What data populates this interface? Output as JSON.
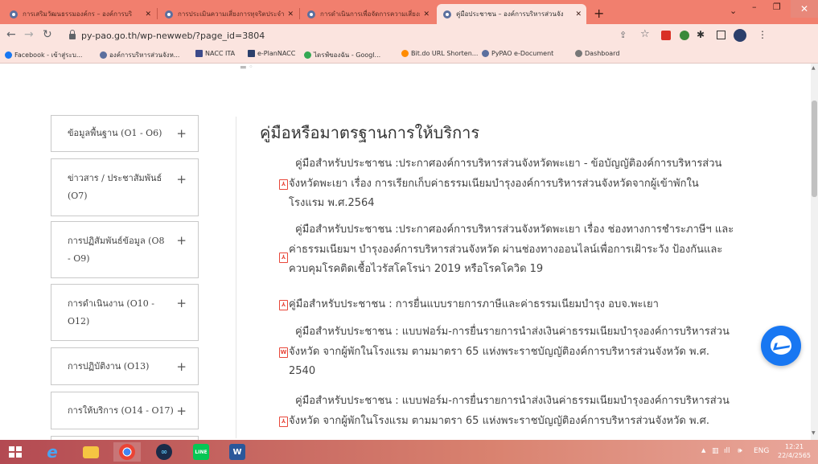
{
  "browser": {
    "tabs": [
      {
        "title": "การเสริมวัฒนธรรมองค์กร – องค์การบริ"
      },
      {
        "title": "การประเมินความเสี่ยงการทุจริตประจำปี"
      },
      {
        "title": "การดำเนินการเพื่อจัดการความเสี่ยงการ"
      },
      {
        "title": "คู่มือประชาชน – องค์การบริหารส่วนจัง",
        "active": true
      }
    ],
    "new_tab": "+",
    "url": "py-pao.go.th/wp-newweb/?page_id=3804",
    "bookmarks": [
      {
        "label": "Facebook - เข้าสู่ระบ...",
        "color": "#1877f2"
      },
      {
        "label": "องค์การบริหารส่วนจังห...",
        "color": "#5b6f9e"
      },
      {
        "label": "NACC ITA",
        "color": "#3c4a8a"
      },
      {
        "label": "e-PlanNACC",
        "color": "#2b3f6b"
      },
      {
        "label": "ไดรฟ์ของฉัน - Googl...",
        "color": "#34a853"
      },
      {
        "label": "Bit.do URL Shorten...",
        "color": "#ff8c00"
      },
      {
        "label": "PyPAO e-Document",
        "color": "#5b6f9e"
      },
      {
        "label": "Dashboard",
        "color": "#777777"
      }
    ]
  },
  "sidebar": {
    "items": [
      {
        "lines": [
          "ข้อมูลพื้นฐาน (O1 - O6)"
        ]
      },
      {
        "lines": [
          "ข่าวสาร / ประชาสัมพันธ์",
          "(O7)"
        ]
      },
      {
        "lines": [
          "การปฏิสัมพันธ์ข้อมูล (O8",
          "- O9)"
        ]
      },
      {
        "lines": [
          "การดำเนินงาน (O10 -",
          "O12)"
        ]
      },
      {
        "lines": [
          "การปฏิบัติงาน (O13)"
        ]
      },
      {
        "lines": [
          "การให้บริการ (O14 - O17)"
        ]
      }
    ],
    "plus": "+"
  },
  "main": {
    "title": "คู่มือหรือมาตรฐานการให้บริการ",
    "docs": [
      {
        "type": "pdf",
        "lines": [
          "คู่มือสำหรับประชาชน :ประกาศองค์การบริหารส่วนจังหวัดพะเยา - ข้อบัญญัติองค์การบริหารส่วน",
          "จังหวัดพะเยา เรื่อง การเรียกเก็บค่าธรรมเนียมบำรุงองค์การบริหารส่วนจังหวัดจากผู้เข้าพักใน",
          "โรงแรม พ.ศ.2564"
        ]
      },
      {
        "type": "pdf",
        "lines": [
          "คู่มือสำหรับประชาชน :ประกาศองค์การบริหารส่วนจังหวัดพะเยา เรื่อง ช่องทางการชำระภาษีฯ และ",
          "ค่าธรรมเนียมฯ บำรุงองค์การบริหารส่วนจังหวัด ผ่านช่องทางออนไลน์เพื่อการเฝ้าระวัง ป้องกันและ",
          "ควบคุมโรคติดเชื้อไวรัสโคโรน่า 2019 หรือโรคโควิด 19"
        ]
      },
      {
        "type": "pdf",
        "lines": [
          "คู่มือสำหรับประชาชน : การยื่นแบบรายการภาษีและค่าธรรมเนียมบำรุง อบจ.พะเยา"
        ]
      },
      {
        "type": "word",
        "lines": [
          "คู่มือสำหรับประชาชน : แบบฟอร์ม-การยื่นรายการนำส่งเงินค่าธรรมเนียมบำรุงองค์การบริหารส่วน",
          "จังหวัด จากผู้พักในโรงแรม ตามมาตรา 65 แห่งพระราชบัญญัติองค์การบริหารส่วนจังหวัด พ.ศ.",
          "2540"
        ]
      },
      {
        "type": "pdf",
        "lines": [
          "คู่มือสำหรับประชาชน : แบบฟอร์ม-การยื่นรายการนำส่งเงินค่าธรรมเนียมบำรุงองค์การบริหารส่วน",
          "จังหวัด จากผู้พักในโรงแรม ตามมาตรา 65 แห่งพระราชบัญญัติองค์การบริหารส่วนจังหวัด พ.ศ."
        ]
      }
    ]
  },
  "taskbar": {
    "lang": "ENG",
    "time": "12:21",
    "date": "22/4/2565"
  }
}
